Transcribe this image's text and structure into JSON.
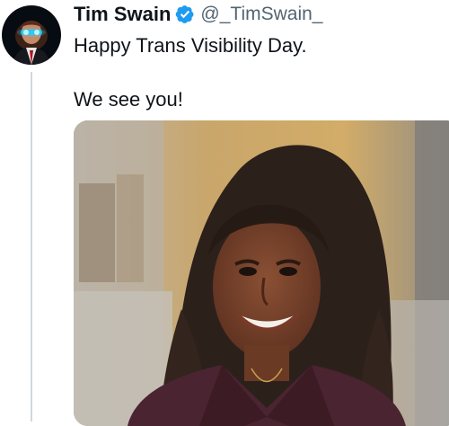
{
  "tweet": {
    "author": {
      "display_name": "Tim Swain",
      "handle": "@_TimSwain_",
      "verified": true,
      "verified_color": "#1d9bf0",
      "avatar_icon": "profile-avatar"
    },
    "text": {
      "line1": "Happy Trans Visibility Day.",
      "line2": "We see you!"
    },
    "media": {
      "type": "photo",
      "icon": "attached-photo"
    }
  },
  "colors": {
    "text_primary": "#0f1419",
    "text_secondary": "#536471",
    "thread_line": "#cfd9de",
    "verified": "#1d9bf0"
  }
}
